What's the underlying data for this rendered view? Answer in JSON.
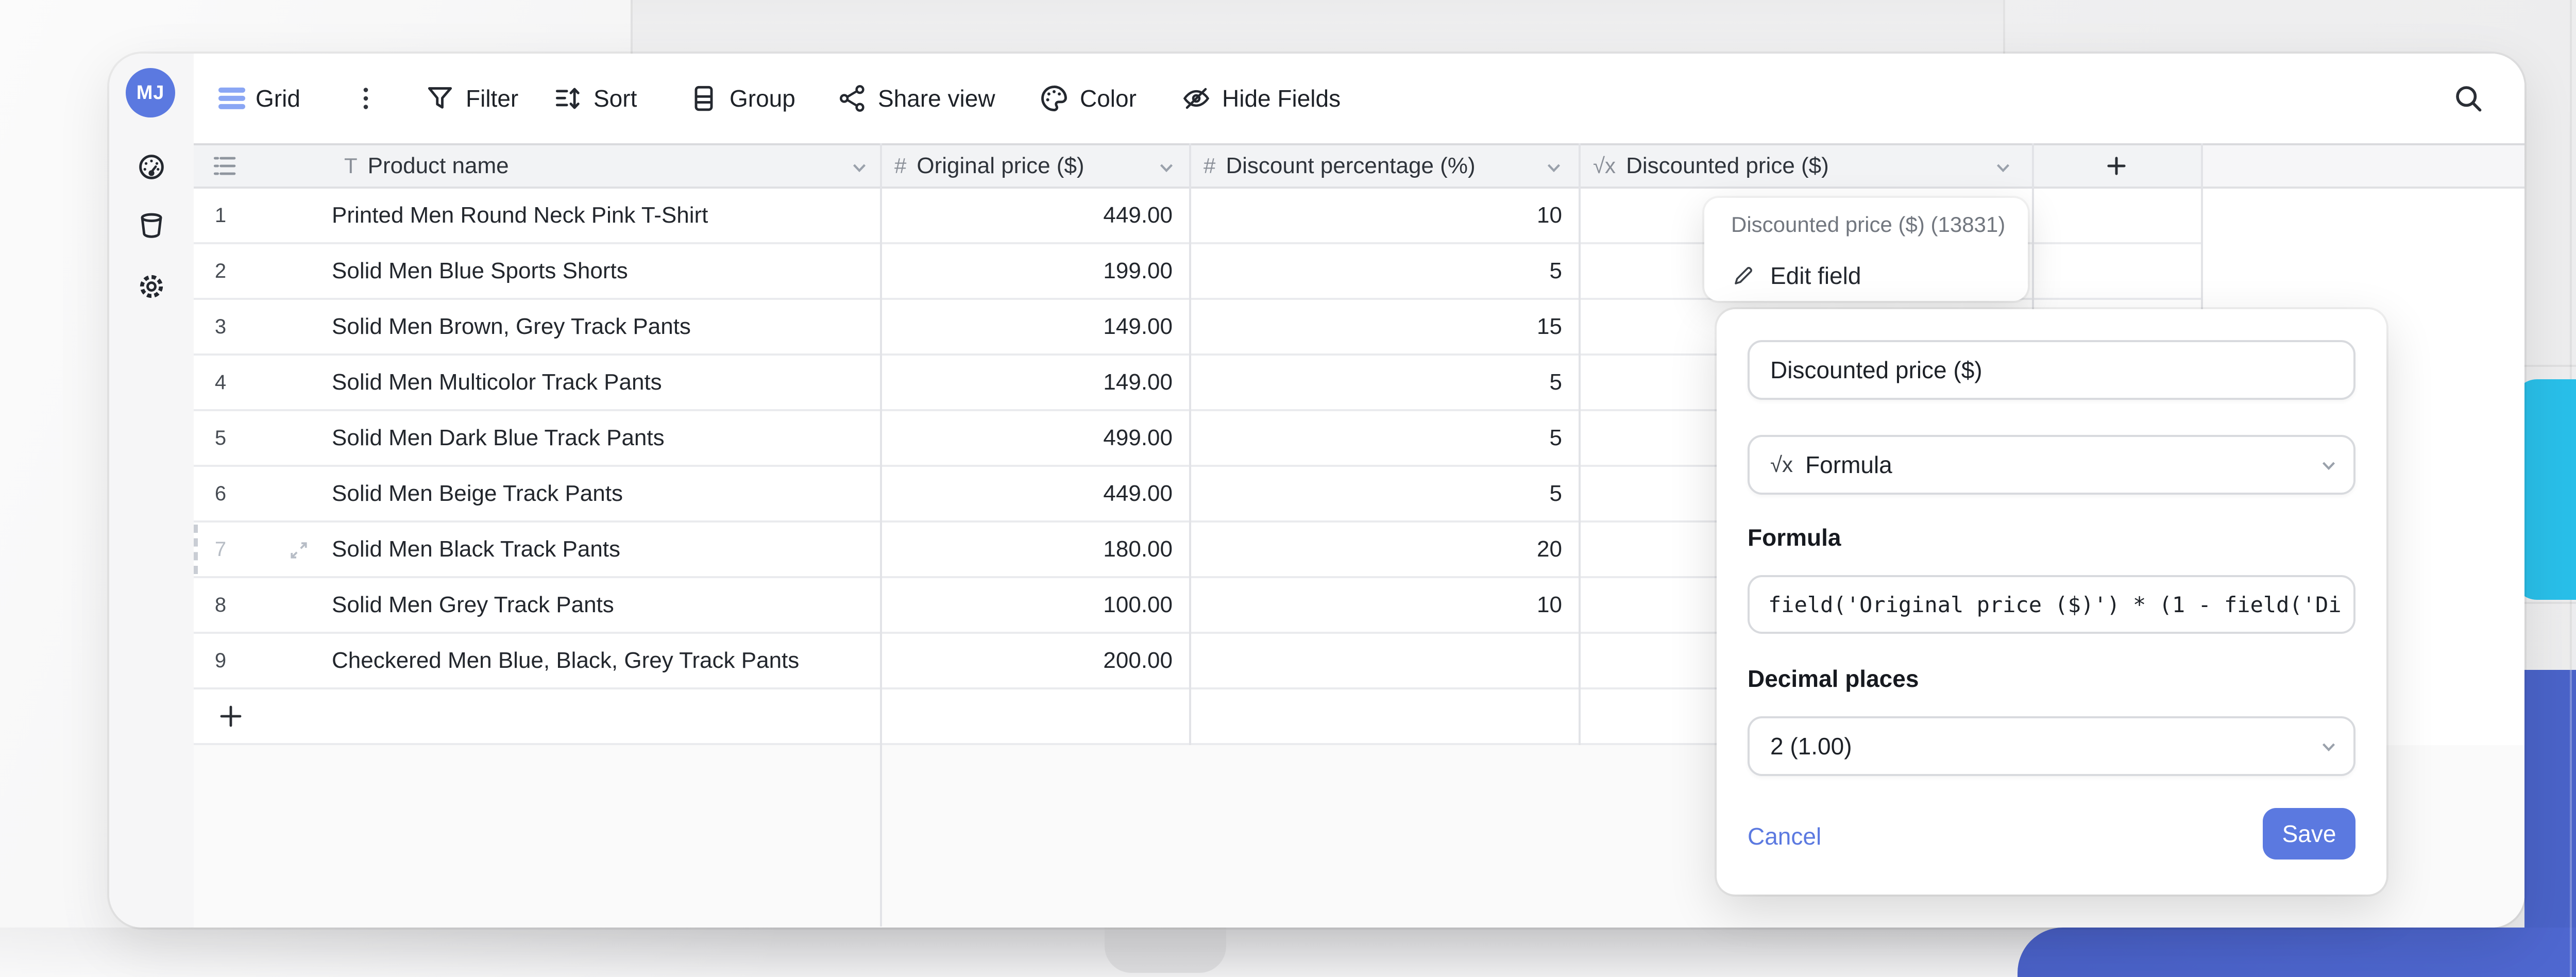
{
  "theme": {
    "accent_blue": "#5b79e0",
    "bg_shape_cyan": "#29bfe9",
    "bg_shape_blue": "#4a63c8"
  },
  "rail": {
    "avatar_initials": "MJ",
    "icons": [
      "dashboard-gauge",
      "trash",
      "settings-gear"
    ]
  },
  "toolbar": {
    "view_label": "Grid",
    "filter_label": "Filter",
    "sort_label": "Sort",
    "group_label": "Group",
    "share_label": "Share view",
    "color_label": "Color",
    "hide_fields_label": "Hide Fields"
  },
  "icons": {
    "text_field": "T",
    "number_field": "#",
    "formula_field": "√x"
  },
  "grid": {
    "columns": [
      {
        "label": "Product name",
        "type": "text"
      },
      {
        "label": "Original price ($)",
        "type": "number"
      },
      {
        "label": "Discount percentage (%)",
        "type": "number"
      },
      {
        "label": "Discounted price ($)",
        "type": "formula"
      }
    ],
    "rows": [
      {
        "n": "1",
        "name": "Printed Men Round Neck Pink T-Shirt",
        "price": "449.00",
        "discount": "10"
      },
      {
        "n": "2",
        "name": "Solid Men Blue Sports Shorts",
        "price": "199.00",
        "discount": "5"
      },
      {
        "n": "3",
        "name": "Solid Men Brown, Grey Track Pants",
        "price": "149.00",
        "discount": "15"
      },
      {
        "n": "4",
        "name": "Solid Men Multicolor Track Pants",
        "price": "149.00",
        "discount": "5"
      },
      {
        "n": "5",
        "name": "Solid Men Dark Blue Track Pants",
        "price": "499.00",
        "discount": "5"
      },
      {
        "n": "6",
        "name": "Solid Men Beige Track Pants",
        "price": "449.00",
        "discount": "5"
      },
      {
        "n": "7",
        "name": "Solid Men Black Track Pants",
        "price": "180.00",
        "discount": "20",
        "hover": true
      },
      {
        "n": "8",
        "name": "Solid Men Grey Track Pants",
        "price": "100.00",
        "discount": "10"
      },
      {
        "n": "9",
        "name": "Checkered Men Blue, Black, Grey Track Pants",
        "price": "200.00",
        "discount": ""
      }
    ]
  },
  "field_menu": {
    "title": "Discounted price ($) (13831)",
    "edit_label": "Edit field"
  },
  "edit_panel": {
    "name_value": "Discounted price ($)",
    "type_value": "Formula",
    "formula_label": "Formula",
    "formula_value": "field('Original price ($)') * (1 - field('Di",
    "decimal_label": "Decimal places",
    "decimal_value": "2 (1.00)",
    "cancel_label": "Cancel",
    "save_label": "Save"
  }
}
